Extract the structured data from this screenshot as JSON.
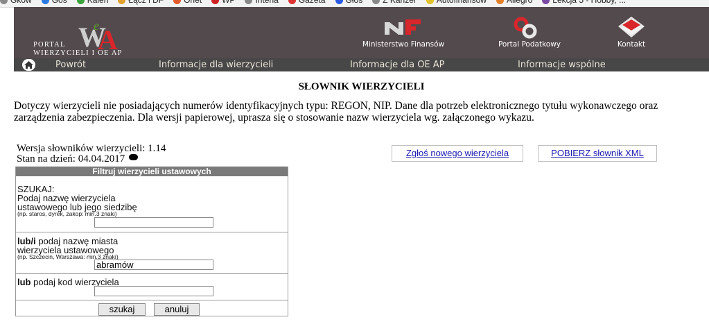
{
  "bookmarks": [
    "Gkow",
    "Gos",
    "Kalen",
    "Łącz i DF",
    "Onet",
    "WP",
    "Interia",
    "Gazeta",
    "Głos",
    "Z Kanzer",
    "Autofinansow",
    "Allegro",
    "Lekcja 5 - Hobby, ..."
  ],
  "header": {
    "portal_line1": "PORTAL",
    "portal_line2": "WIERZYCIELI I OE AP",
    "logo_letters": "WA",
    "logo_small": "e",
    "links": {
      "ministry": "Ministerstwo Finansów",
      "tax_portal": "Portal Podatkowy",
      "contact": "Kontakt"
    }
  },
  "nav": {
    "back": "Powrót",
    "creditors_info": "Informacje dla wierzycieli",
    "oe_info": "Informacje dla OE AP",
    "common_info": "Informacje wspólne"
  },
  "main": {
    "title": "SŁOWNIK WIERZYCIELI",
    "description": "Dotyczy wierzycieli nie posiadających numerów identyfikacyjnych typu: REGON, NIP. Dane dla potrzeb elektronicznego tytułu wykonawczego oraz zarządzenia zabezpieczenia. Dla wersji papierowej, uprasza się o stosowanie nazw wierzyciela wg. załączonego wykazu.",
    "version_text": "Wersja słowników wierzycieli: 1.14",
    "date_text": "Stan na dzień: 04.04.2017",
    "report_new_label": "Zgłoś nowego wierzyciela",
    "download_xml_label": "POBIERZ słownik XML"
  },
  "filter": {
    "header": "Filtruj wierzycieli ustawowych",
    "search_label": "SZUKAJ:",
    "name_label_line1": "Podaj nazwę wierzyciela",
    "name_label_line2": "ustawowego lub jego siedzibę",
    "name_hint": "(np. staros, dyrek, zakop: min.3 znaki)",
    "name_value": "",
    "city_prefix": "lub/i",
    "city_label_line1_rest": " podaj nazwę miasta",
    "city_label_line2": "wierzyciela ustawowego",
    "city_hint": "(np. Szczecin, Warszawa: min.3 znaki)",
    "city_value": "abramów",
    "code_prefix": "lub",
    "code_label_rest": " podaj kod wierzyciela",
    "code_value": "",
    "search_button": "szukaj",
    "cancel_button": "anuluj"
  },
  "colors": {
    "header_bg": "#534a4d",
    "nav_bg": "#474747",
    "nav_text": "#e8e4d8",
    "link_blue": "#1a1ab0",
    "logo_green": "#5aa02c",
    "logo_red": "#d9262b",
    "filter_head_bg": "#7a7a7a"
  },
  "icons": [
    "home-icon",
    "ministry-logo-icon",
    "tax-portal-logo-icon",
    "contact-envelope-icon",
    "download-icon"
  ]
}
